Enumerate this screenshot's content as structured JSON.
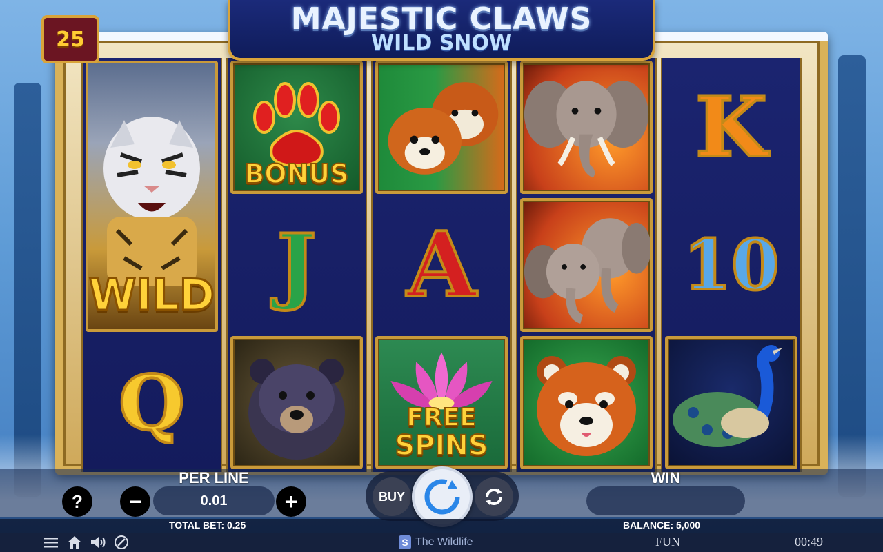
{
  "game": {
    "title": "MAJESTIC CLAWS",
    "subtitle": "WILD SNOW",
    "lines": "25"
  },
  "reels": {
    "col1": {
      "wild_label": "WILD",
      "q_label": "Q"
    },
    "col2": {
      "bonus_label": "BONUS",
      "j_label": "J"
    },
    "col3": {
      "a_label": "A",
      "free_spins_label_1": "FREE",
      "free_spins_label_2": "SPINS"
    },
    "col5": {
      "k_label": "K",
      "ten_label": "10"
    }
  },
  "controls": {
    "help_label": "?",
    "per_line_label": "PER LINE",
    "minus_label": "−",
    "bet_value": "0.01",
    "plus_label": "+",
    "buy_label": "BUY",
    "win_label": "WIN",
    "win_value": ""
  },
  "info": {
    "total_bet": "TOTAL BET: 0.25",
    "balance": "BALANCE: 5,000"
  },
  "system": {
    "brand": "The Wildlife",
    "brand_logo": "S",
    "mode": "FUN",
    "clock": "00:49",
    "icons": [
      "menu-icon",
      "home-icon",
      "sound-icon",
      "turbo-icon"
    ]
  },
  "colors": {
    "reel_bg": "#1b2470",
    "frame_gold": "#d9b259",
    "gold_text": "#ffcc33",
    "banner_blue": "#0f1c5a"
  }
}
